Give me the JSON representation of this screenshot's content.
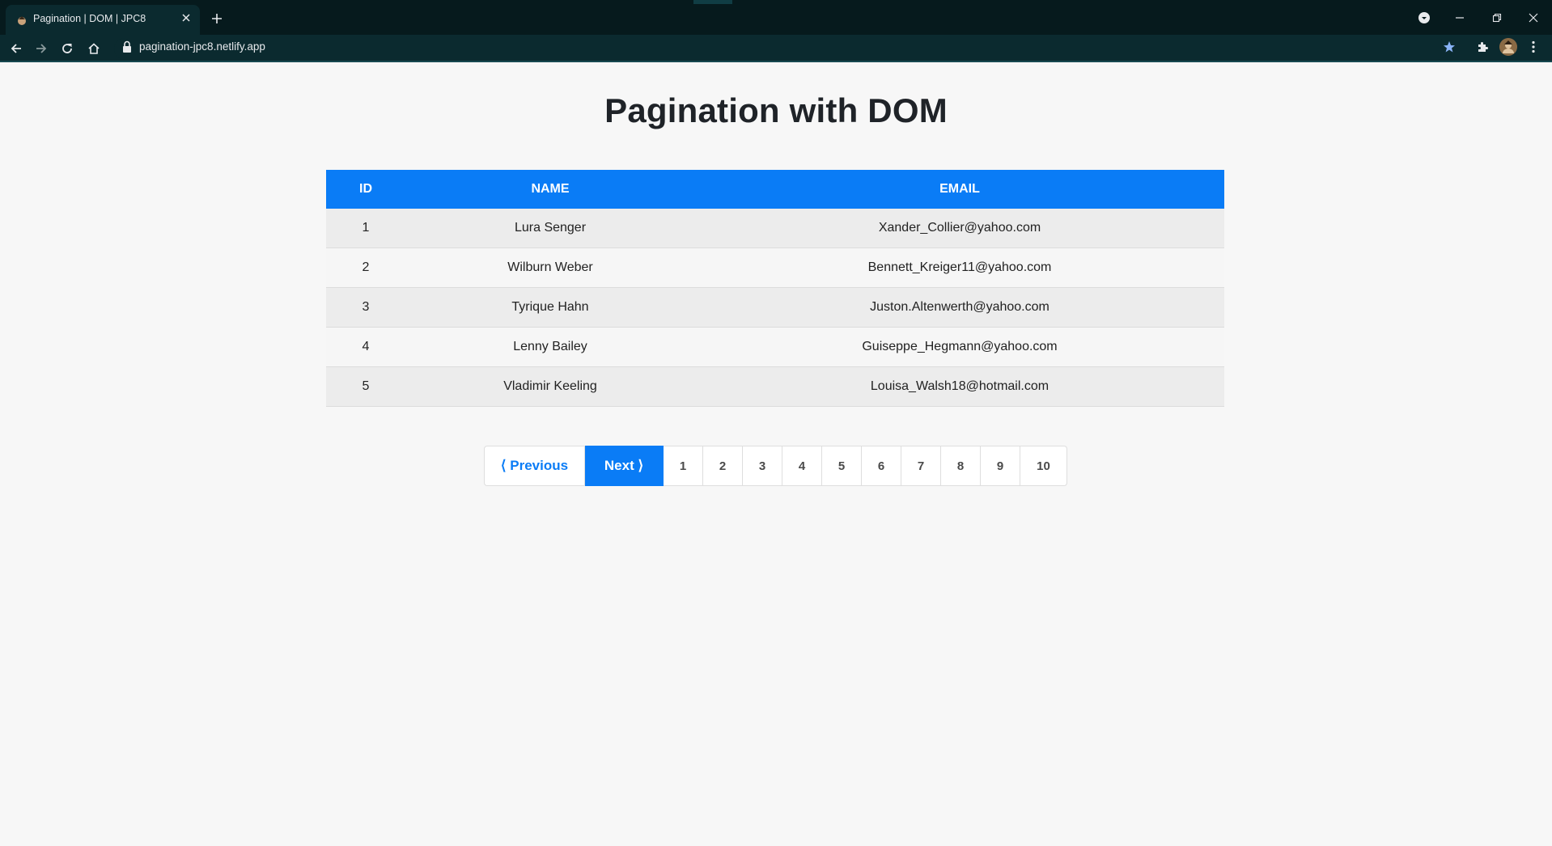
{
  "browser": {
    "tab_title": "Pagination | DOM | JPC8",
    "url": "pagination-jpc8.netlify.app"
  },
  "page": {
    "heading": "Pagination with DOM"
  },
  "table": {
    "headers": [
      "ID",
      "NAME",
      "EMAIL"
    ],
    "rows": [
      {
        "id": "1",
        "name": "Lura Senger",
        "email": "Xander_Collier@yahoo.com"
      },
      {
        "id": "2",
        "name": "Wilburn Weber",
        "email": "Bennett_Kreiger11@yahoo.com"
      },
      {
        "id": "3",
        "name": "Tyrique Hahn",
        "email": "Juston.Altenwerth@yahoo.com"
      },
      {
        "id": "4",
        "name": "Lenny Bailey",
        "email": "Guiseppe_Hegmann@yahoo.com"
      },
      {
        "id": "5",
        "name": "Vladimir Keeling",
        "email": "Louisa_Walsh18@hotmail.com"
      }
    ]
  },
  "pagination": {
    "previous_label": "⟨ Previous",
    "next_label": "Next ⟩",
    "pages": [
      "1",
      "2",
      "3",
      "4",
      "5",
      "6",
      "7",
      "8",
      "9",
      "10"
    ]
  },
  "colors": {
    "accent": "#0a7cf6",
    "chrome_dark": "#061a1d",
    "chrome_toolbar": "#0b2a2f"
  }
}
